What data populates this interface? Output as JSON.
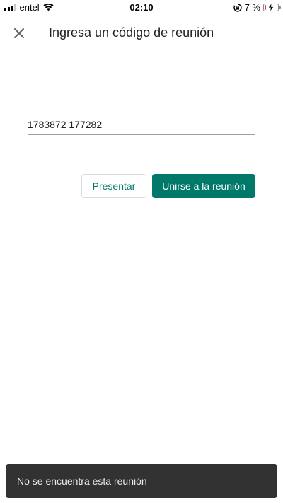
{
  "status_bar": {
    "carrier": "entel",
    "time": "02:10",
    "battery_percent_text": "7 %",
    "battery_level": 0.07,
    "battery_color": "#e53935"
  },
  "header": {
    "close_icon": "close-icon",
    "title": "Ingresa un código de reunión"
  },
  "meeting_code": {
    "value": "1783872 177282"
  },
  "actions": {
    "present_label": "Presentar",
    "join_label": "Unirse a la reunión"
  },
  "snackbar": {
    "message": "No se encuentra esta reunión"
  },
  "colors": {
    "accent": "#00796b",
    "snackbar_bg": "#323232"
  }
}
